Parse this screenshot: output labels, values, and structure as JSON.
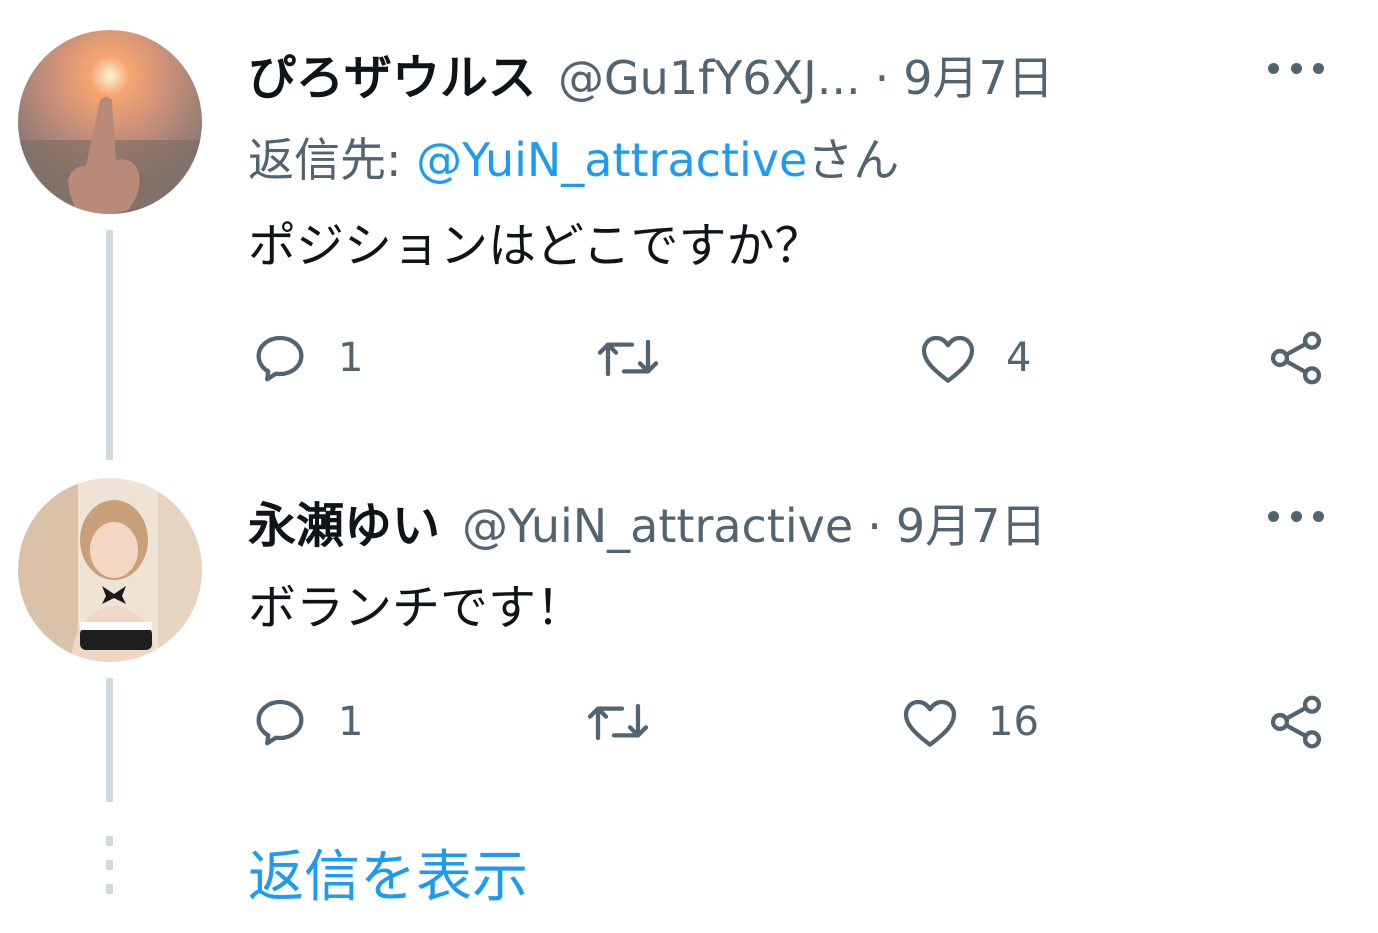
{
  "tweets": [
    {
      "display_name": "ぴろザウルス",
      "handle": "@Gu1fY6XJ...",
      "separator": "·",
      "date": "9月7日",
      "reply_to_prefix": "返信先: ",
      "reply_to_mention": "@YuiN_attractive",
      "reply_to_suffix": "さん",
      "text": "ポジションはどこですか？",
      "reply_count": "1",
      "like_count": "4"
    },
    {
      "display_name": "永瀬ゆい",
      "handle": "@YuiN_attractive",
      "separator": "·",
      "date": "9月7日",
      "text": "ボランチです！",
      "reply_count": "1",
      "like_count": "16"
    }
  ],
  "show_replies_label": "返信を表示",
  "colors": {
    "link": "#1d9bf0",
    "secondary_text": "#536471",
    "thread_line": "#cfd9de"
  },
  "icons": [
    "more-icon",
    "reply-icon",
    "retweet-icon",
    "like-icon",
    "share-icon"
  ]
}
